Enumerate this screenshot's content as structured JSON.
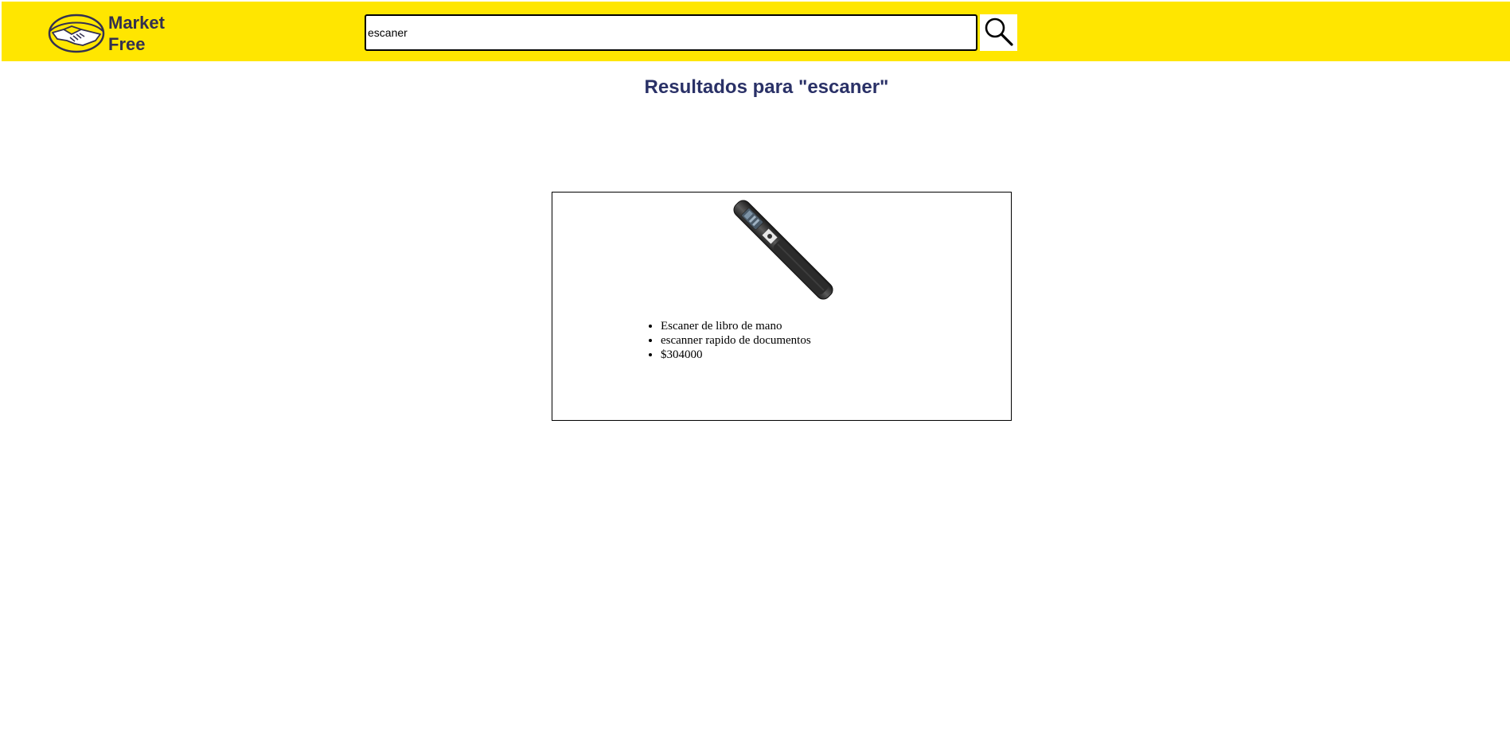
{
  "header": {
    "brand_line1": "Market",
    "brand_line2": "Free",
    "logo_icon": "handshake-icon",
    "background_color": "#ffe600"
  },
  "search": {
    "value": "escaner",
    "button_icon": "search-icon"
  },
  "results": {
    "title": "Resultados para \"escaner\"",
    "title_color": "#2a3167"
  },
  "products": [
    {
      "image": "handheld-scanner-image",
      "name": "Escaner de libro de mano",
      "description": "escanner rapido de documentos",
      "price": "$304000"
    }
  ]
}
